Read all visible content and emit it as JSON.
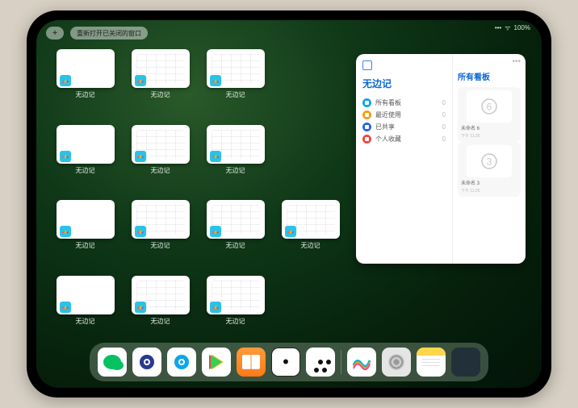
{
  "status": {
    "signal": "•••",
    "wifi": "ᯤ",
    "battery": "100%"
  },
  "topbar": {
    "plus": "+",
    "pill_label": "重新打开已关闭的窗口"
  },
  "app_label": "无边记",
  "thumbs": [
    {
      "blank": true
    },
    {
      "blank": false
    },
    {
      "blank": false
    },
    {
      "blank": true
    },
    {
      "blank": false
    },
    {
      "blank": false
    },
    {
      "blank": true
    },
    {
      "blank": false
    },
    {
      "blank": false
    },
    {
      "blank": false
    },
    {
      "blank": true
    },
    {
      "blank": false
    },
    {
      "blank": false
    }
  ],
  "panel": {
    "title": "无边记",
    "rows": [
      {
        "icon_color": "#0ea5e9",
        "label": "所有看板",
        "count": 0
      },
      {
        "icon_color": "#f59e0b",
        "label": "最近使用",
        "count": 0
      },
      {
        "icon_color": "#2563eb",
        "label": "已共享",
        "count": 0
      },
      {
        "icon_color": "#ef4444",
        "label": "个人收藏",
        "count": 0
      }
    ],
    "right_title": "所有看板",
    "cards": [
      {
        "glyph": "6",
        "caption": "未命名 6",
        "sub": "下午 11:26"
      },
      {
        "glyph": "3",
        "caption": "未命名 3",
        "sub": "下午 11:25"
      }
    ]
  },
  "dock": {
    "items": [
      "wechat",
      "circle-blue",
      "circle-cyan",
      "play",
      "books",
      "dice",
      "graph"
    ],
    "recents": [
      "freeform",
      "settings",
      "notes",
      "folder"
    ]
  }
}
